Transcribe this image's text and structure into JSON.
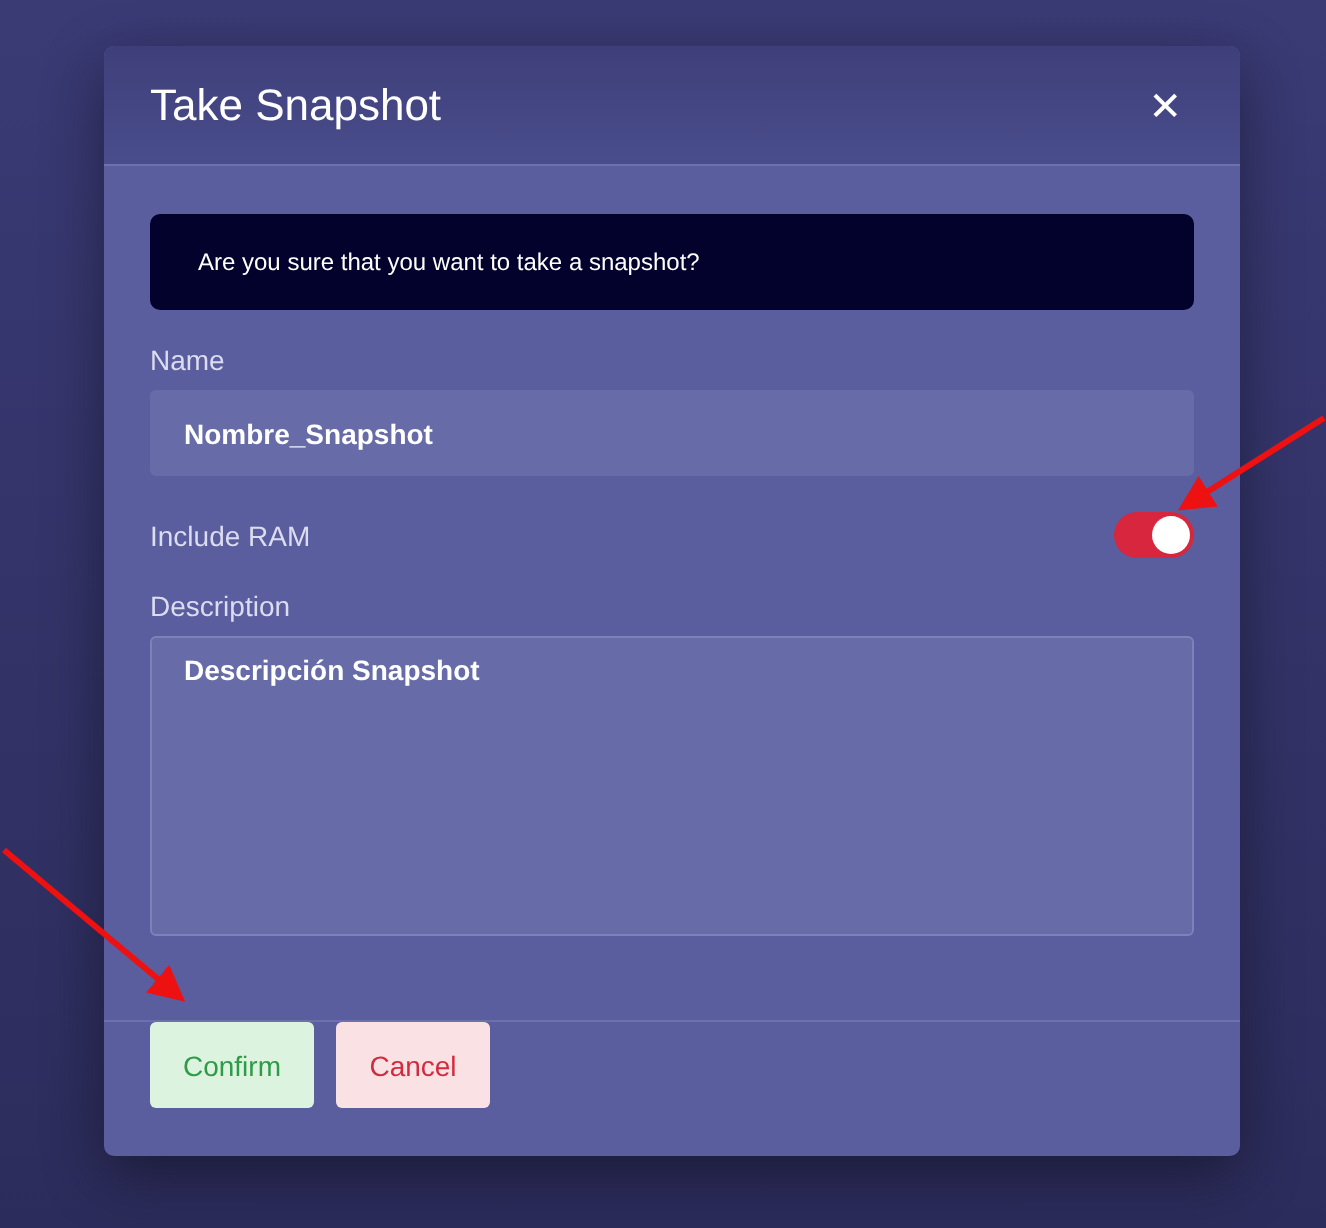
{
  "dialog": {
    "title": "Take Snapshot",
    "close": "✕"
  },
  "alert": "Are you sure that you want to take a snapshot?",
  "name_field": {
    "label": "Name",
    "value": "Nombre_Snapshot"
  },
  "include_ram": {
    "label": "Include RAM",
    "on": true
  },
  "description_field": {
    "label": "Description",
    "value": "Descripción Snapshot"
  },
  "buttons": [
    {
      "label": "Confirm",
      "kind": "confirm"
    },
    {
      "label": "Cancel",
      "kind": "cancel"
    }
  ]
}
